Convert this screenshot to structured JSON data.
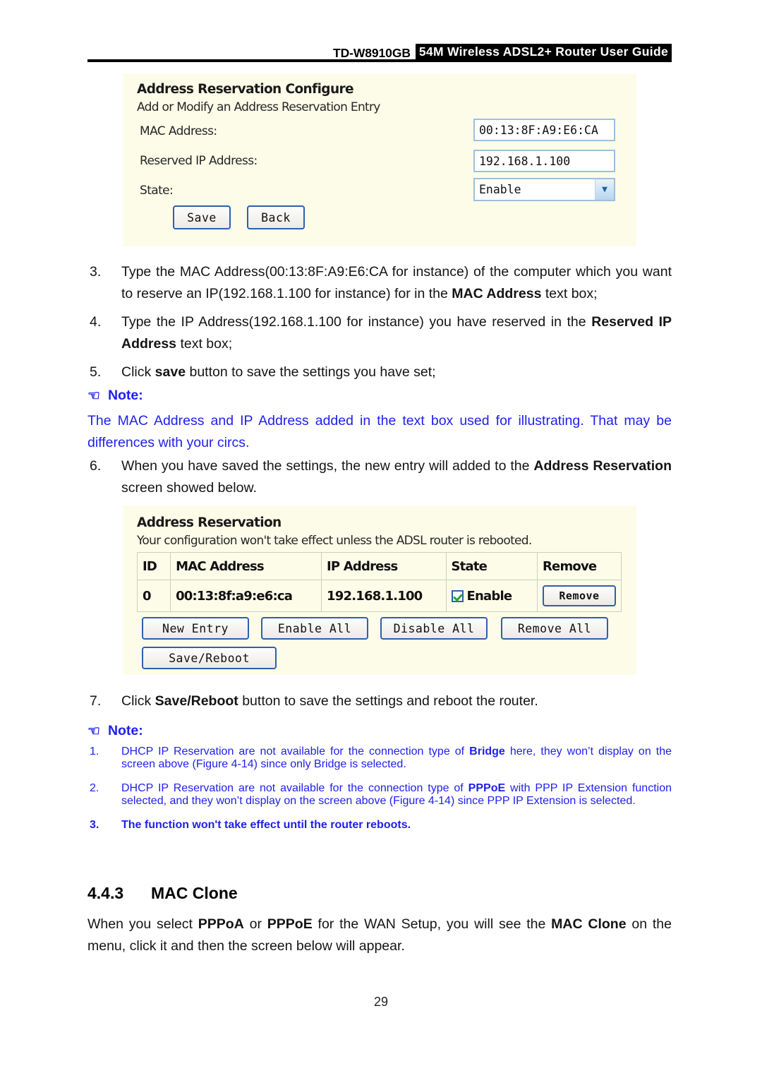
{
  "header": {
    "model": "TD-W8910GB",
    "title": "54M Wireless ADSL2+ Router User Guide"
  },
  "panel1": {
    "title": "Address Reservation Configure",
    "subtitle": "Add or Modify an Address Reservation Entry",
    "fields": [
      {
        "label": "MAC Address:",
        "value": "00:13:8F:A9:E6:CA"
      },
      {
        "label": "Reserved IP Address:",
        "value": "192.168.1.100"
      },
      {
        "label": "State:",
        "value": "Enable"
      }
    ],
    "buttons": [
      {
        "label": "Save"
      },
      {
        "label": "Back"
      }
    ]
  },
  "steps_a": {
    "items": [
      {
        "marker": "3.",
        "parts": [
          {
            "t": "Type the MAC Address(00:13:8F:A9:E6:CA for instance) of the computer which you want to reserve an IP(192.168.1.100 for instance) for in the "
          },
          {
            "t": "MAC Address",
            "b": true
          },
          {
            "t": " text box;"
          }
        ]
      },
      {
        "marker": "4.",
        "parts": [
          {
            "t": "Type the IP Address(192.168.1.100 for instance) you have reserved in the "
          },
          {
            "t": "Reserved IP Address",
            "b": true
          },
          {
            "t": " text box;"
          }
        ]
      },
      {
        "marker": "5.",
        "parts": [
          {
            "t": "Click "
          },
          {
            "t": "save",
            "b": true
          },
          {
            "t": " button to save the settings you have set;"
          }
        ]
      }
    ]
  },
  "note1": {
    "hand": "pointing-hand-icon",
    "label": "Note:",
    "body": "The MAC Address and IP Address added in the text box used for illustrating. That may be differences with your circs."
  },
  "steps_b": {
    "items": [
      {
        "marker": "6.",
        "parts": [
          {
            "t": "When you have saved the settings, the new entry will added to the "
          },
          {
            "t": "Address Reservation",
            "b": true
          },
          {
            "t": " screen showed below."
          }
        ]
      }
    ]
  },
  "panel2": {
    "title": "Address Reservation",
    "subtitle": "Your configuration won't take effect unless the ADSL router is rebooted.",
    "columns": [
      "ID",
      "MAC Address",
      "IP Address",
      "State",
      "Remove"
    ],
    "rows": [
      {
        "id": "0",
        "mac": "00:13:8f:a9:e6:ca",
        "ip": "192.168.1.100",
        "state": "Enable",
        "state_checked": true,
        "remove_label": "Remove"
      }
    ],
    "buttons": [
      {
        "label": "New Entry"
      },
      {
        "label": "Enable All"
      },
      {
        "label": "Disable All"
      },
      {
        "label": "Remove All"
      },
      {
        "label": "Save/Reboot"
      }
    ]
  },
  "steps_c": {
    "items": [
      {
        "marker": "7.",
        "parts": [
          {
            "t": "Click "
          },
          {
            "t": "Save/Reboot",
            "b": true
          },
          {
            "t": " button to save the settings and reboot the router."
          }
        ]
      }
    ]
  },
  "note2": {
    "hand": "pointing-hand-icon",
    "label": "Note:",
    "items": [
      {
        "marker": "1.",
        "bold": false,
        "parts": [
          {
            "t": "DHCP IP Reservation are not available for the connection type of "
          },
          {
            "t": "Bridge",
            "b": true
          },
          {
            "t": " here, they won’t display on the screen above (Figure 4-14) since only Bridge is selected."
          }
        ]
      },
      {
        "marker": "2.",
        "bold": false,
        "parts": [
          {
            "t": "DHCP IP Reservation are not available for the connection type of "
          },
          {
            "t": "PPPoE",
            "b": true
          },
          {
            "t": " with PPP IP Extension function selected, and they won’t display on the screen above (Figure 4-14) since PPP IP Extension is selected."
          }
        ]
      },
      {
        "marker": "3.",
        "bold": true,
        "parts": [
          {
            "t": "The function won't take effect until the router reboots."
          }
        ]
      }
    ]
  },
  "section": {
    "number": "4.4.3",
    "title": "MAC Clone"
  },
  "closing": {
    "parts": [
      {
        "t": "When you select "
      },
      {
        "t": "PPPoA",
        "b": true
      },
      {
        "t": " or "
      },
      {
        "t": "PPPoE",
        "b": true
      },
      {
        "t": " for the WAN Setup, you will see the "
      },
      {
        "t": "MAC Clone",
        "b": true
      },
      {
        "t": " on the menu, click it and then the screen below will appear."
      }
    ]
  },
  "footer": {
    "page_number": "29"
  },
  "colors": {
    "note_blue": "#2020ef",
    "panel_bg": "#fcfce9",
    "input_border": "#9dc0dc",
    "button_border": "#2f5fae",
    "table_border": "#c6d2bc",
    "check_green": "#22aa22"
  }
}
